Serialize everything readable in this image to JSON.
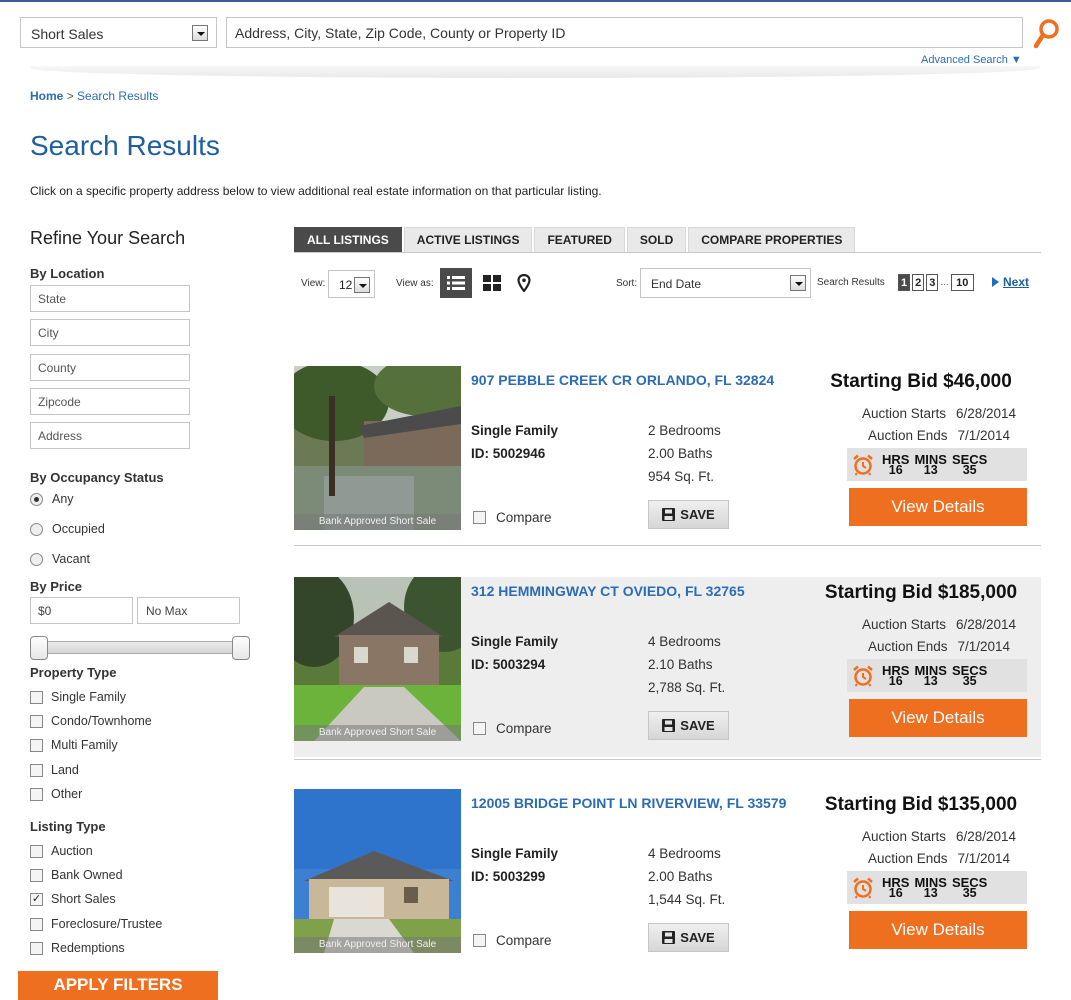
{
  "search": {
    "type_value": "Short Sales",
    "placeholder": "Address, City, State, Zip Code, County or Property ID",
    "advanced_label": "Advanced Search ▼"
  },
  "breadcrumb": {
    "home": "Home",
    "separator": ">",
    "current": "Search Results"
  },
  "page_title": "Search Results",
  "intro": "Click on a specific property address below to view additional real estate information on that particular listing.",
  "sidebar": {
    "title": "Refine Your Search",
    "by_location": "By Location",
    "location_fields": [
      "State",
      "City",
      "County",
      "Zipcode",
      "Address"
    ],
    "by_occupancy": "By Occupancy Status",
    "occupancy_options": [
      {
        "label": "Any",
        "selected": true
      },
      {
        "label": "Occupied",
        "selected": false
      },
      {
        "label": "Vacant",
        "selected": false
      }
    ],
    "by_price": "By Price",
    "price_min": "$0",
    "price_max": "No Max",
    "property_type_label": "Property Type",
    "property_types": [
      {
        "label": "Single Family",
        "checked": false
      },
      {
        "label": "Condo/Townhome",
        "checked": false
      },
      {
        "label": "Multi Family",
        "checked": false
      },
      {
        "label": "Land",
        "checked": false
      },
      {
        "label": "Other",
        "checked": false
      }
    ],
    "listing_type_label": "Listing Type",
    "listing_types": [
      {
        "label": "Auction",
        "checked": false
      },
      {
        "label": "Bank Owned",
        "checked": false
      },
      {
        "label": "Short Sales",
        "checked": true
      },
      {
        "label": "Foreclosure/Trustee",
        "checked": false
      },
      {
        "label": "Redemptions",
        "checked": false
      }
    ],
    "apply_label": "APPLY FILTERS"
  },
  "tabs": [
    {
      "label": "ALL LISTINGS",
      "active": true
    },
    {
      "label": "ACTIVE LISTINGS",
      "active": false
    },
    {
      "label": "FEATURED",
      "active": false
    },
    {
      "label": "SOLD",
      "active": false
    },
    {
      "label": "COMPARE PROPERTIES",
      "active": false
    }
  ],
  "toolbar": {
    "view_label": "View:",
    "view_value": "12",
    "view_as_label": "View as:",
    "view_modes": [
      "list-icon",
      "grid-icon",
      "map-pin-icon"
    ],
    "sort_label": "Sort:",
    "sort_value": "End Date",
    "results_label": "Search Results",
    "pages": [
      "1",
      "2",
      "3"
    ],
    "page_dots": "...",
    "last_page": "10",
    "current_page": "1",
    "next_label": "Next"
  },
  "listings": [
    {
      "address": "907 PEBBLE CREEK CR ORLANDO, FL 32824",
      "property_type": "Single Family",
      "id": "ID: 5002946",
      "beds": "2 Bedrooms",
      "baths": "2.00 Baths",
      "sqft": "954 Sq. Ft.",
      "compare_label": "Compare",
      "save_label": "SAVE",
      "starting_bid": "Starting Bid $46,000",
      "starts_label": "Auction Starts",
      "starts": "6/28/2014",
      "ends_label": "Auction Ends",
      "ends": "7/1/2014",
      "hrs_label": "HRS",
      "hrs": "16",
      "mins_label": "MINS",
      "mins": "13",
      "secs_label": "SECS",
      "secs": "35",
      "photo_caption": "Bank Approved Short Sale",
      "view_label": "View Details"
    },
    {
      "address": "312 HEMMINGWAY CT OVIEDO, FL 32765",
      "property_type": "Single Family",
      "id": "ID: 5003294",
      "beds": "4 Bedrooms",
      "baths": "2.10 Baths",
      "sqft": "2,788 Sq. Ft.",
      "compare_label": "Compare",
      "save_label": "SAVE",
      "starting_bid": "Starting Bid $185,000",
      "starts_label": "Auction Starts",
      "starts": "6/28/2014",
      "ends_label": "Auction Ends",
      "ends": "7/1/2014",
      "hrs_label": "HRS",
      "hrs": "16",
      "mins_label": "MINS",
      "mins": "13",
      "secs_label": "SECS",
      "secs": "35",
      "photo_caption": "Bank Approved Short Sale",
      "view_label": "View Details"
    },
    {
      "address": "12005 BRIDGE POINT LN RIVERVIEW, FL 33579",
      "property_type": "Single Family",
      "id": "ID: 5003299",
      "beds": "4 Bedrooms",
      "baths": "2.00 Baths",
      "sqft": "1,544 Sq. Ft.",
      "compare_label": "Compare",
      "save_label": "SAVE",
      "starting_bid": "Starting Bid $135,000",
      "starts_label": "Auction Starts",
      "starts": "6/28/2014",
      "ends_label": "Auction Ends",
      "ends": "7/1/2014",
      "hrs_label": "HRS",
      "hrs": "16",
      "mins_label": "MINS",
      "mins": "13",
      "secs_label": "SECS",
      "secs": "35",
      "photo_caption": "Bank Approved Short Sale",
      "view_label": "View Details"
    }
  ],
  "colors": {
    "accent_orange": "#ee6f1f",
    "link_blue": "#2b6cb5",
    "title_blue": "#1f5ea0",
    "tab_active": "#4a4a4a"
  }
}
